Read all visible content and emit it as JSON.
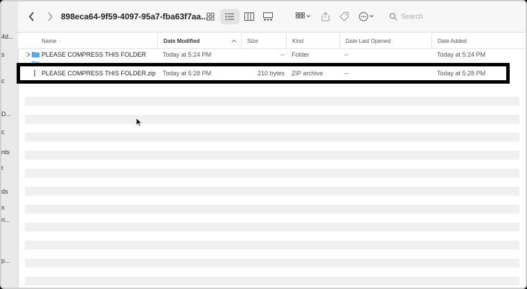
{
  "window": {
    "title": "898eca64-9f59-4097-95a7-fba63f7aa...",
    "search_placeholder": "Search"
  },
  "sidebar_fragments": [
    "4d...",
    "s",
    "c",
    "D...",
    "c",
    "nts",
    "t",
    "ds",
    "s",
    "ri...",
    "p..."
  ],
  "columns": {
    "name": "Name",
    "date_modified": "Date Modified",
    "size": "Size",
    "kind": "Kind",
    "date_last_opened": "Date Last Opened",
    "date_added": "Date Added"
  },
  "rows": [
    {
      "name": "PLEASE COMPRESS THIS FOLDER",
      "date_modified": "Today at 5:24 PM",
      "size": "--",
      "kind": "Folder",
      "date_last_opened": "--",
      "date_added": "Today at 5:24 PM"
    },
    {
      "name": "PLEASE COMPRESS THIS FOLDER.zip",
      "date_modified": "Today at 5:28 PM",
      "size": "210 bytes",
      "kind": "ZIP archive",
      "date_last_opened": "--",
      "date_added": "Today at 5:28 PM"
    }
  ],
  "colors": {
    "folder": "#5aa9e6",
    "highlight_border": "#000000",
    "stripe": "#f0f0f0"
  }
}
